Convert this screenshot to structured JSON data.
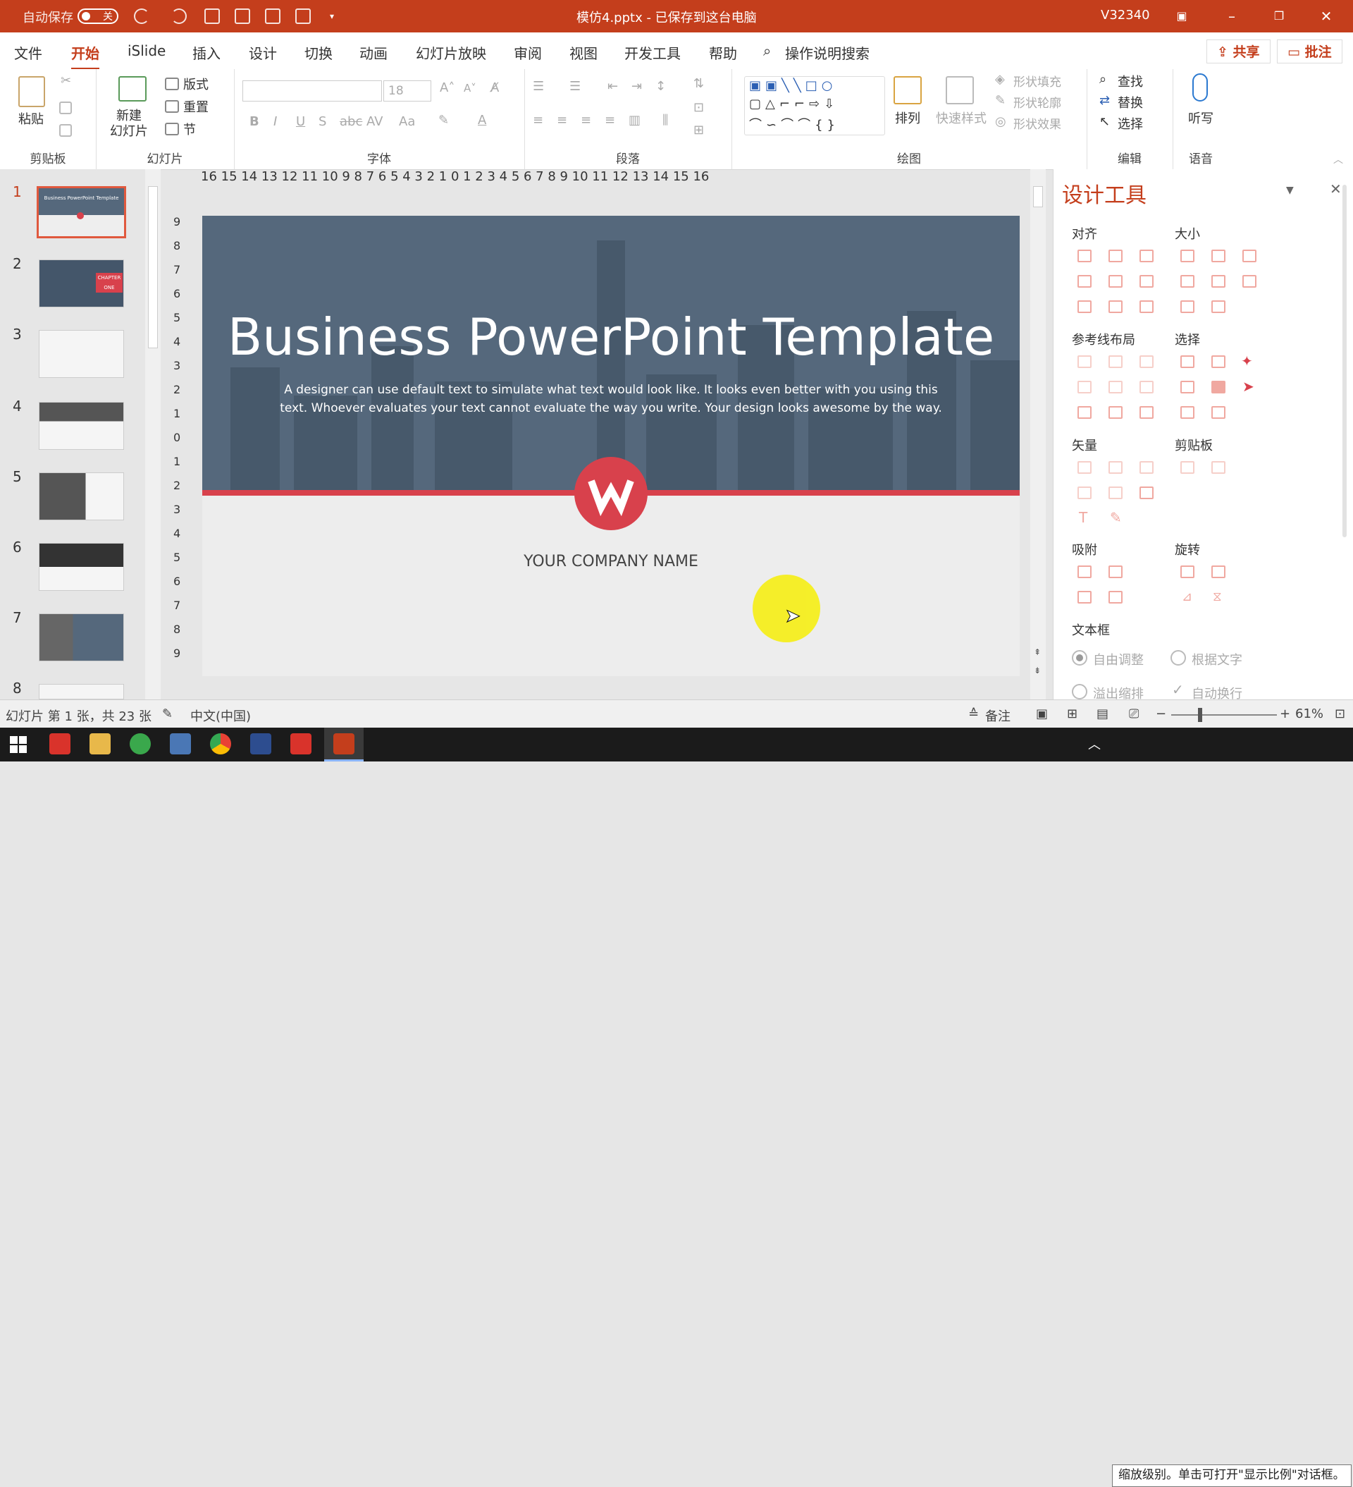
{
  "titlebar": {
    "autosave_label": "自动保存",
    "autosave_state": "关",
    "document_title": "模仿4.pptx - 已保存到这台电脑",
    "user": "V32340",
    "bg_color": "#c43e1c"
  },
  "menu": {
    "tabs": [
      "文件",
      "开始",
      "iSlide",
      "插入",
      "设计",
      "切换",
      "动画",
      "幻灯片放映",
      "审阅",
      "视图",
      "开发工具",
      "帮助"
    ],
    "active_tab": "开始",
    "search_label": "操作说明搜索",
    "share_label": "共享",
    "comment_label": "批注"
  },
  "ribbon": {
    "clipboard": {
      "group": "剪贴板",
      "paste": "粘贴"
    },
    "slides": {
      "group": "幻灯片",
      "new_slide": "新建\n幻灯片",
      "layout": "版式",
      "reset": "重置",
      "section": "节"
    },
    "font": {
      "group": "字体",
      "font_size": "18",
      "bold": "B",
      "italic": "I",
      "underline": "U",
      "shadow": "S",
      "strike": "abc",
      "case": "Aa"
    },
    "paragraph": {
      "group": "段落"
    },
    "drawing": {
      "group": "绘图",
      "arrange": "排列",
      "quick_styles": "快速样式",
      "shape_fill": "形状填充",
      "shape_outline": "形状轮廓",
      "shape_effects": "形状效果"
    },
    "editing": {
      "group": "编辑",
      "find": "查找",
      "replace": "替换",
      "select": "选择"
    },
    "voice": {
      "group": "语音",
      "dictate": "听写"
    }
  },
  "thumbnails": {
    "numbers": [
      "1",
      "2",
      "3",
      "4",
      "5",
      "6",
      "7",
      "8"
    ],
    "selected": 1,
    "slide1_title": "Business PowerPoint Template",
    "slide2_text": "CHAPTER ONE"
  },
  "ruler": {
    "horizontal": "16 15 14 13 12 11 10 9 8 7 6 5 4 3 2 1 0 1 2 3 4 5 6 7 8 9 10 11 12 13 14 15 16",
    "vertical": [
      "9",
      "8",
      "7",
      "6",
      "5",
      "4",
      "3",
      "2",
      "1",
      "0",
      "1",
      "2",
      "3",
      "4",
      "5",
      "6",
      "7",
      "8",
      "9"
    ]
  },
  "slide": {
    "title": "Business PowerPoint Template",
    "body": "A designer can use default text to simulate what text would look like. It looks even better with you using this text. Whoever evaluates your text cannot evaluate the way you write. Your design looks awesome by the way.",
    "company": "YOUR COMPANY NAME",
    "accent_color": "#d8414c",
    "hero_color": "#55687c"
  },
  "design_pane": {
    "title": "设计工具",
    "sections": {
      "align": "对齐",
      "size": "大小",
      "guides": "参考线布局",
      "select": "选择",
      "vector": "矢量",
      "clipboard": "剪贴板",
      "snap": "吸附",
      "rotate": "旋转",
      "textbox": "文本框"
    },
    "options": {
      "free_adjust": "自由调整",
      "fit_text": "根据文字",
      "overflow_shrink": "溢出缩排",
      "auto_wrap": "自动换行"
    }
  },
  "statusbar": {
    "slide_info": "幻灯片 第 1 张，共 23 张",
    "language": "中文(中国)",
    "notes": "备注",
    "zoom": "61%"
  },
  "taskbar": {
    "tooltip": "缩放级别。单击可打开\"显示比例\"对话框。"
  }
}
